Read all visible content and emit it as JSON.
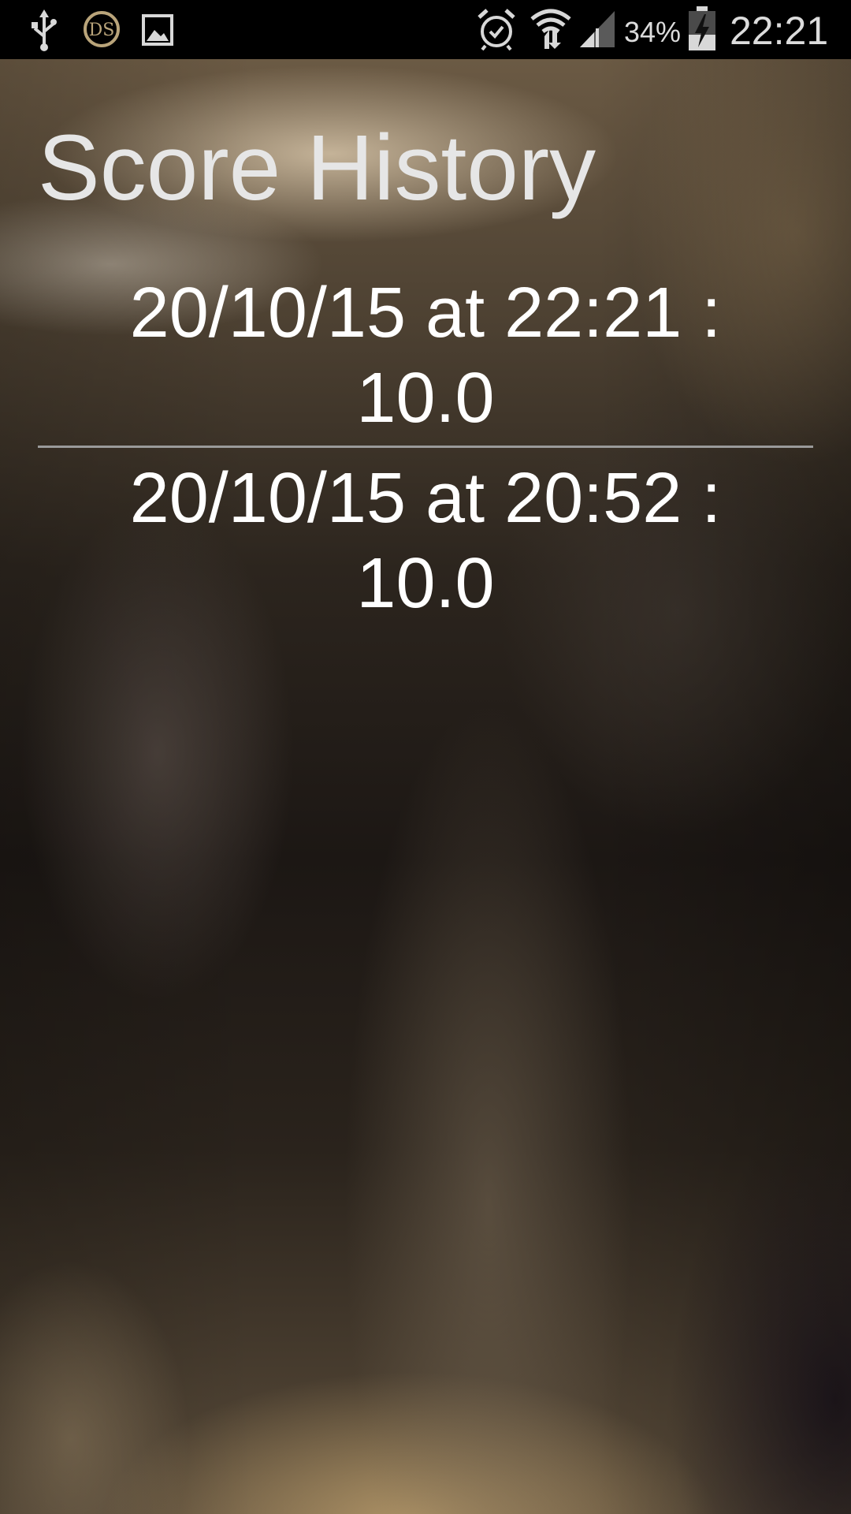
{
  "status_bar": {
    "icons": [
      "usb-icon",
      "ds-app-icon",
      "gallery-icon",
      "alarm-icon",
      "wifi-icon",
      "signal-icon",
      "battery-charging-icon"
    ],
    "battery_percent": "34%",
    "time": "22:21"
  },
  "page": {
    "title": "Score History"
  },
  "history": {
    "entries": [
      {
        "line1": "20/10/15 at 22:21 :",
        "line2": "10.0"
      },
      {
        "line1": "20/10/15 at 20:52 :",
        "line2": "10.0"
      }
    ]
  }
}
